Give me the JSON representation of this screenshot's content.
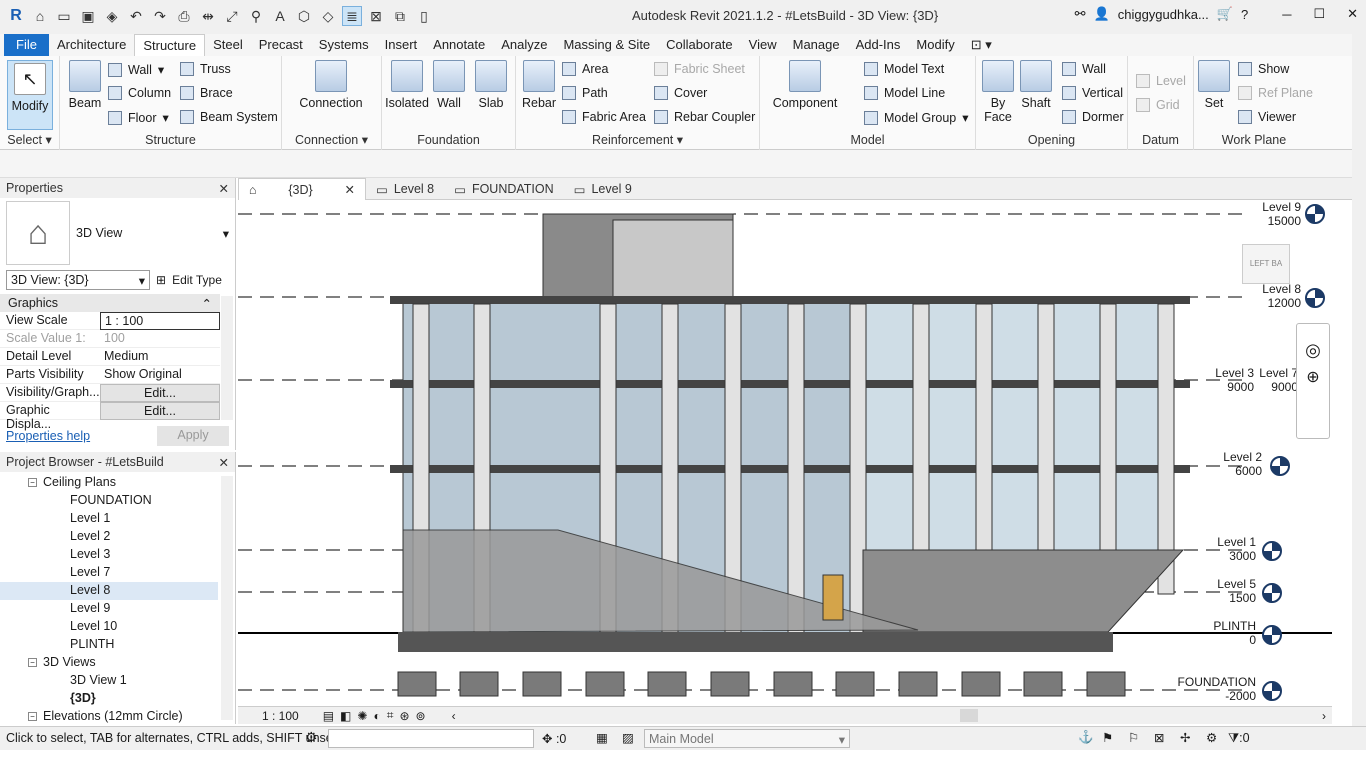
{
  "app": {
    "title": "Autodesk Revit 2021.1.2 - #LetsBuild - 3D View: {3D}",
    "user": "chiggygudhka...",
    "logo": "R"
  },
  "ribbon_tabs": [
    "File",
    "Architecture",
    "Structure",
    "Steel",
    "Precast",
    "Systems",
    "Insert",
    "Annotate",
    "Analyze",
    "Massing & Site",
    "Collaborate",
    "View",
    "Manage",
    "Add-Ins",
    "Modify"
  ],
  "active_tab": "Structure",
  "ribbon": {
    "select": {
      "modify": "Modify",
      "label": "Select"
    },
    "structure": {
      "beam": "Beam",
      "wall": "Wall",
      "column": "Column",
      "floor": "Floor",
      "truss": "Truss",
      "brace": "Brace",
      "beam_system": "Beam System",
      "label": "Structure"
    },
    "connection": {
      "connection": "Connection",
      "label": "Connection"
    },
    "foundation": {
      "isolated": "Isolated",
      "wall": "Wall",
      "slab": "Slab",
      "label": "Foundation"
    },
    "reinforcement": {
      "rebar": "Rebar",
      "area": "Area",
      "path": "Path",
      "fabric_area": "Fabric Area",
      "fabric_sheet": "Fabric Sheet",
      "cover": "Cover",
      "rebar_coupler": "Rebar Coupler",
      "label": "Reinforcement"
    },
    "model": {
      "component": "Component",
      "model_text": "Model Text",
      "model_line": "Model Line",
      "model_group": "Model Group",
      "label": "Model"
    },
    "opening": {
      "by_face": "By Face",
      "shaft": "Shaft",
      "wall": "Wall",
      "vertical": "Vertical",
      "dormer": "Dormer",
      "label": "Opening"
    },
    "datum": {
      "level": "Level",
      "grid": "Grid",
      "label": "Datum"
    },
    "work_plane": {
      "set": "Set",
      "show": "Show",
      "ref_plane": "Ref Plane",
      "viewer": "Viewer",
      "label": "Work Plane"
    }
  },
  "properties": {
    "header": "Properties",
    "type_name": "3D View",
    "selector": "3D View: {3D}",
    "edit_type": "Edit Type",
    "group": "Graphics",
    "rows": [
      {
        "k": "View Scale",
        "v": "1 : 100"
      },
      {
        "k": "Scale Value    1:",
        "v": "100"
      },
      {
        "k": "Detail Level",
        "v": "Medium"
      },
      {
        "k": "Parts Visibility",
        "v": "Show Original"
      },
      {
        "k": "Visibility/Graph...",
        "v": "Edit..."
      },
      {
        "k": "Graphic Displa...",
        "v": "Edit..."
      }
    ],
    "help": "Properties help",
    "apply": "Apply"
  },
  "browser": {
    "header": "Project Browser - #LetsBuild",
    "nodes": [
      "Ceiling Plans",
      "FOUNDATION",
      "Level 1",
      "Level 2",
      "Level 3",
      "Level 7",
      "Level 8",
      "Level 9",
      "Level 10",
      "PLINTH",
      "3D Views",
      "3D View 1",
      "{3D}",
      "Elevations (12mm Circle)"
    ]
  },
  "view_tabs": [
    "{3D}",
    "Level 8",
    "FOUNDATION",
    "Level 9"
  ],
  "levels": [
    {
      "name": "Level 9",
      "elev": "15000"
    },
    {
      "name": "Level 8",
      "elev": "12000"
    },
    {
      "name": "Level 3",
      "elev": "9000"
    },
    {
      "name": "Level 7",
      "elev": "9000"
    },
    {
      "name": "Level 2",
      "elev": "6000"
    },
    {
      "name": "Level 1",
      "elev": "3000"
    },
    {
      "name": "Level 5",
      "elev": "1500"
    },
    {
      "name": "PLINTH",
      "elev": "0"
    },
    {
      "name": "FOUNDATION",
      "elev": "-2000"
    }
  ],
  "view_bar": {
    "scale": "1 : 100"
  },
  "viewcube": {
    "left": "LEFT",
    "back": "BA"
  },
  "status": {
    "message": "Click to select, TAB for alternates, CTRL adds, SHIFT unse",
    "count": ":0",
    "model": "Main Model",
    "filter": ":0"
  }
}
